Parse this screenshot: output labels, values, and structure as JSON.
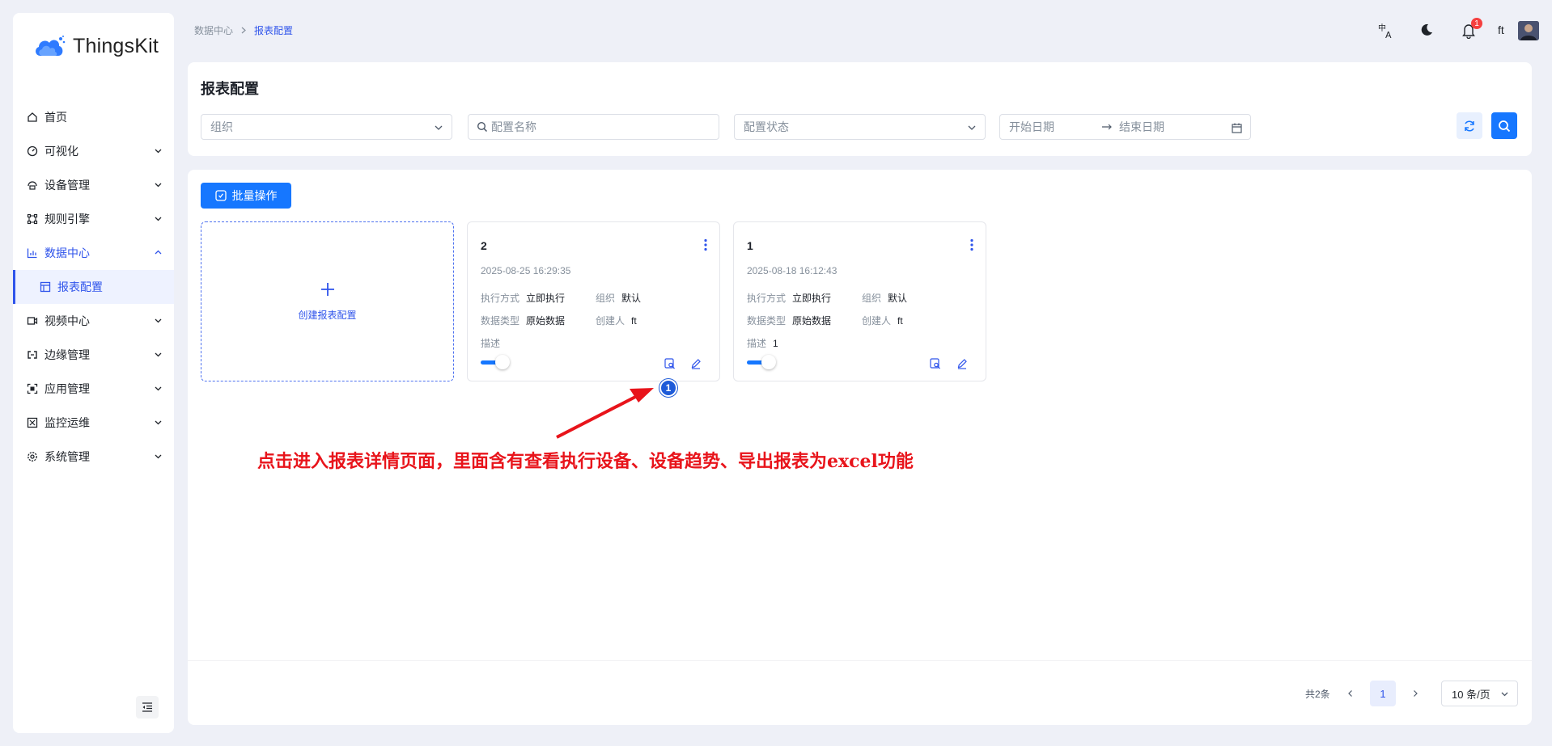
{
  "app": {
    "name": "ThingsKit"
  },
  "breadcrumb": {
    "root": "数据中心",
    "current": "报表配置"
  },
  "header": {
    "user": "ft",
    "notification_count": "1"
  },
  "sidebar": {
    "items": [
      {
        "label": "首页",
        "icon": "home-icon"
      },
      {
        "label": "可视化",
        "icon": "dashboard-icon"
      },
      {
        "label": "设备管理",
        "icon": "device-icon"
      },
      {
        "label": "规则引擎",
        "icon": "rule-icon"
      },
      {
        "label": "数据中心",
        "icon": "chart-icon"
      },
      {
        "label": "报表配置",
        "icon": "report-icon"
      },
      {
        "label": "视频中心",
        "icon": "video-icon"
      },
      {
        "label": "边缘管理",
        "icon": "edge-icon"
      },
      {
        "label": "应用管理",
        "icon": "app-icon"
      },
      {
        "label": "监控运维",
        "icon": "monitor-icon"
      },
      {
        "label": "系统管理",
        "icon": "settings-icon"
      }
    ]
  },
  "page": {
    "title": "报表配置"
  },
  "filters": {
    "org_placeholder": "组织",
    "name_placeholder": "配置名称",
    "status_placeholder": "配置状态",
    "start_date_placeholder": "开始日期",
    "end_date_placeholder": "结束日期"
  },
  "toolbar": {
    "batch_label": "批量操作"
  },
  "create_card": {
    "label": "创建报表配置"
  },
  "field_labels": {
    "exec": "执行方式",
    "org": "组织",
    "data_type": "数据类型",
    "creator": "创建人",
    "desc": "描述"
  },
  "reports": [
    {
      "name": "2",
      "date": "2025-08-25 16:29:35",
      "exec": "立即执行",
      "org": "默认",
      "data_type": "原始数据",
      "creator": "ft",
      "desc": "",
      "enabled": true
    },
    {
      "name": "1",
      "date": "2025-08-18 16:12:43",
      "exec": "立即执行",
      "org": "默认",
      "data_type": "原始数据",
      "creator": "ft",
      "desc": "1",
      "enabled": true
    }
  ],
  "annotation": {
    "step": "1",
    "text": "点击进入报表详情页面，里面含有查看执行设备、设备趋势、导出报表为excel功能",
    "color": "#e8141b"
  },
  "pagination": {
    "total": "共2条",
    "current_page": "1",
    "page_size": "10 条/页"
  },
  "colors": {
    "primary": "#1677ff",
    "accent": "#2f54eb"
  }
}
